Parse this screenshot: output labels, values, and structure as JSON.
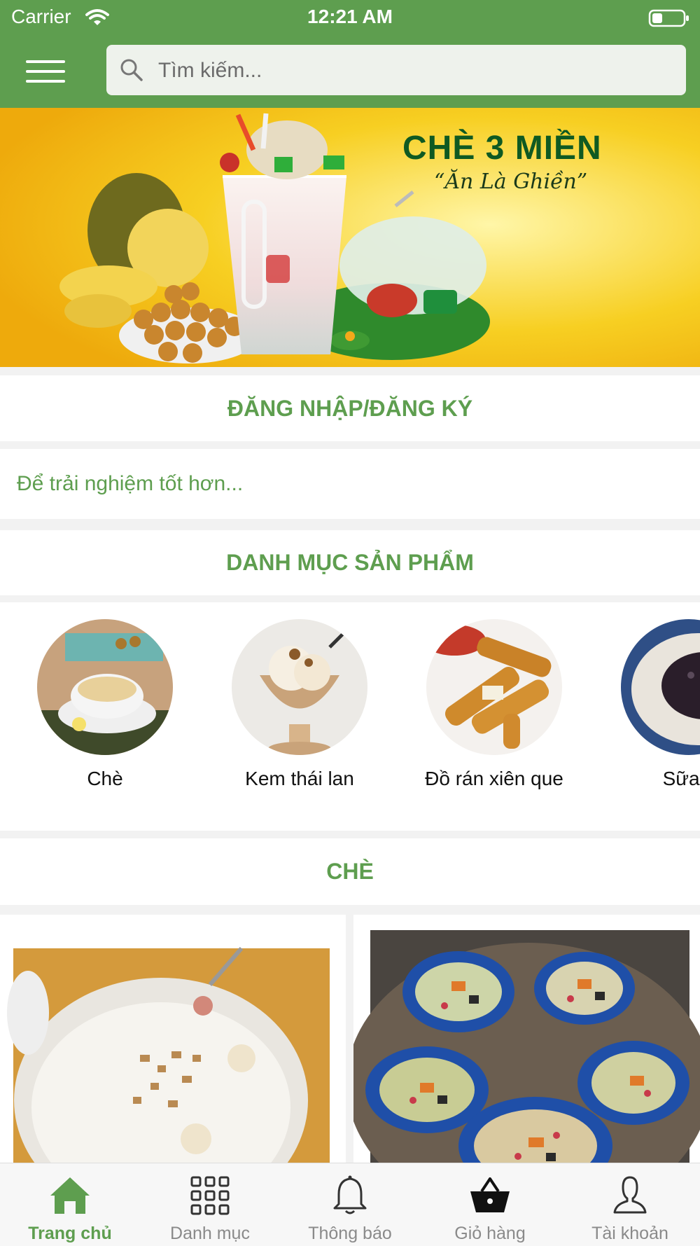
{
  "status_bar": {
    "carrier": "Carrier",
    "time": "12:21 AM"
  },
  "search": {
    "placeholder": "Tìm kiếm..."
  },
  "banner": {
    "title": "CHÈ 3 MIỀN",
    "slogan": "“Ăn Là Ghiền”"
  },
  "login": {
    "label": "ĐĂNG NHẬP/ĐĂNG KÝ",
    "prompt": "Để trải nghiệm tốt hơn..."
  },
  "categories": {
    "title": "DANH MỤC SẢN PHẨM",
    "items": [
      {
        "label": "Chè"
      },
      {
        "label": "Kem thái lan"
      },
      {
        "label": "Đồ rán xiên que"
      },
      {
        "label": "Sữa c"
      }
    ]
  },
  "featured_section": {
    "title": "CHÈ"
  },
  "tab_bar": {
    "items": [
      {
        "label": "Trang chủ",
        "icon": "home-icon"
      },
      {
        "label": "Danh mục",
        "icon": "grid-icon"
      },
      {
        "label": "Thông báo",
        "icon": "bell-icon"
      },
      {
        "label": "Giỏ hàng",
        "icon": "basket-icon"
      },
      {
        "label": "Tài khoản",
        "icon": "user-icon"
      }
    ]
  },
  "colors": {
    "brand_green": "#5e9e4f",
    "banner_yellow": "#f6c21a",
    "inactive_gray": "#8a8a8a"
  }
}
